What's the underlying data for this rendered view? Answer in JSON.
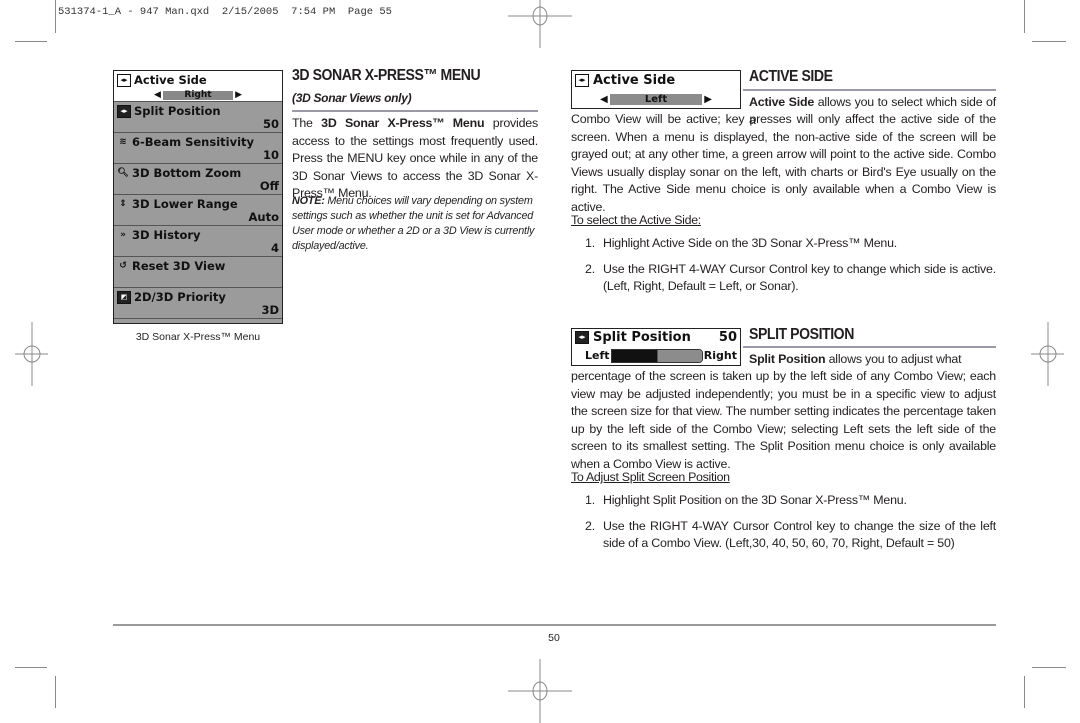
{
  "slug": "531374-1_A - 947 Man.qxd  2/15/2005  7:54 PM  Page 55",
  "menu_screen": {
    "items": [
      {
        "label": "Active Side",
        "icon": "active-side-icon",
        "value": "Right",
        "selected": true
      },
      {
        "label": "Split Position",
        "icon": "split-position-icon",
        "value": "50"
      },
      {
        "label": "6-Beam Sensitivity",
        "icon": "beam-sensitivity-icon",
        "value": "10"
      },
      {
        "label": "3D Bottom Zoom",
        "icon": "zoom-icon",
        "value": "Off"
      },
      {
        "label": "3D Lower Range",
        "icon": "lower-range-icon",
        "value": "Auto"
      },
      {
        "label": "3D History",
        "icon": "history-icon",
        "value": "4"
      },
      {
        "label": "Reset 3D View",
        "icon": "reset-icon",
        "value": ""
      },
      {
        "label": "2D/3D Priority",
        "icon": "priority-icon",
        "value": "3D"
      }
    ],
    "caption": "3D Sonar X-Press™ Menu"
  },
  "intro": {
    "title": "3D SONAR X-PRESS™ MENU",
    "subtitle": "(3D Sonar Views only)",
    "para_pre": "The ",
    "para_bold": "3D Sonar X-Press™ Menu",
    "para_post": " provides access to the settings most frequently used. Press the MENU key once while in any of the 3D Sonar Views to access the 3D Sonar X-Press™ Menu.",
    "note_label": "NOTE:",
    "note_text": " Menu choices will vary depending on system settings such as whether the unit is set for Advanced User mode or whether a 2D or a 3D View is currently displayed/active."
  },
  "active_side": {
    "screen_label": "Active Side",
    "screen_value": "Left",
    "title": "ACTIVE SIDE",
    "para_bold": "Active Side",
    "para_first": " allows you to select which side of a",
    "para_rest": "Combo View will be active; key presses will only affect the active side of the screen. When a menu is displayed, the non-active side of the screen will be grayed out; at any other time, a green arrow will point to the active side. Combo Views usually display sonar on the left, with charts or Bird's Eye usually on the right. The Active Side menu choice is only available when a Combo View is active.",
    "steps_heading": "To select the Active Side:",
    "steps": [
      {
        "n": "1.",
        "text": "Highlight Active Side on the 3D Sonar X-Press™ Menu."
      },
      {
        "n": "2.",
        "text": "Use the RIGHT 4-WAY Cursor Control key to change which side is active. (Left, Right, Default = Left, or Sonar)."
      }
    ]
  },
  "split_position": {
    "screen_label": "Split Position",
    "screen_value": "50",
    "slider_left": "Left",
    "slider_right": "Right",
    "slider_fraction": 0.5,
    "title": "SPLIT POSITION",
    "para_bold": "Split Position",
    "para_first": " allows you to adjust what",
    "para_rest": "percentage of the screen is taken up by the left side of any Combo View; each view may be adjusted independently; you must be in a specific view to adjust the screen size for that view. The number setting indicates the percentage taken up by the left side of the Combo View; selecting Left sets the left side of the screen to its smallest setting. The Split Position menu choice is only available when a Combo View is active.",
    "steps_heading": "To Adjust Split Screen Position",
    "steps": [
      {
        "n": "1.",
        "text": "Highlight Split Position on the 3D Sonar X-Press™ Menu."
      },
      {
        "n": "2.",
        "text": "Use the RIGHT 4-WAY Cursor Control key to change the size of the left side of a Combo View. (Left,30, 40, 50, 60, 70, Right, Default = 50)"
      }
    ]
  },
  "page_number": "50"
}
